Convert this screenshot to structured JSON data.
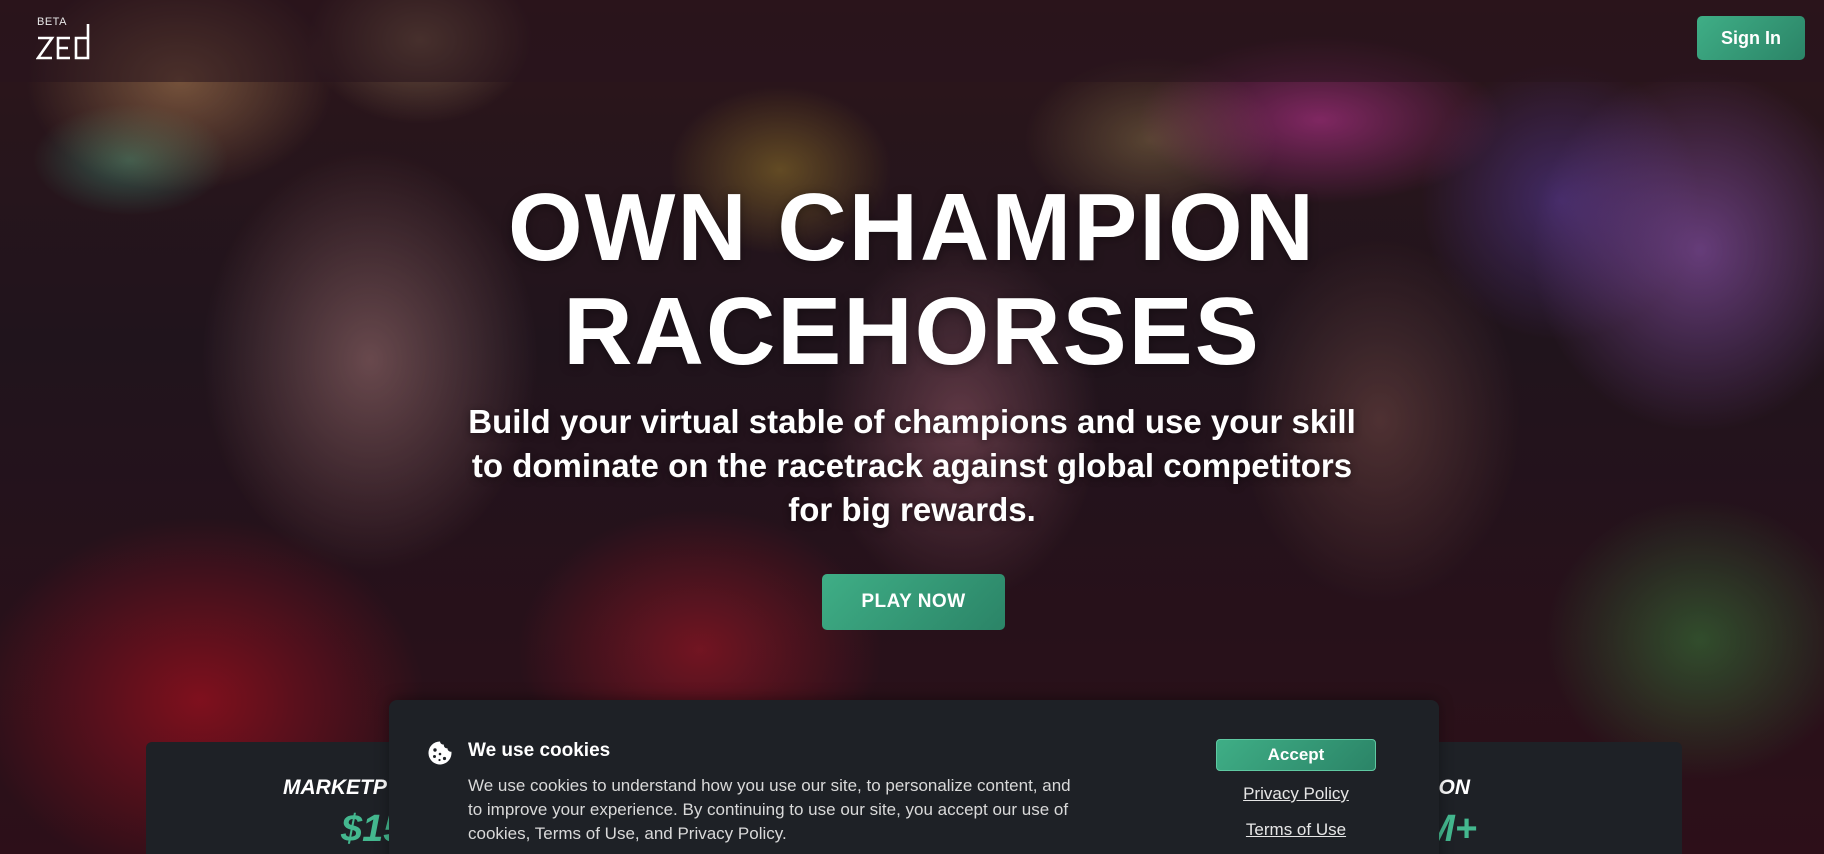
{
  "header": {
    "logo_badge": "BETA",
    "logo_text": "zed",
    "signin_label": "Sign In"
  },
  "hero": {
    "title_line1": "OWN CHAMPION",
    "title_line2": "RACEHORSES",
    "subtitle": "Build your virtual stable of champions and use your skill to dominate on the racetrack against global competitors for big rewards.",
    "cta_label": "PLAY NOW"
  },
  "stats": {
    "left_label_visible": "MARKETP",
    "left_value_visible": "$15",
    "right_label_visible": "ON",
    "right_value_visible": "M+"
  },
  "cookie_banner": {
    "title": "We use cookies",
    "body": "We use cookies to understand how you use our site, to personalize content, and to improve your experience. By continuing to use our site, you accept our use of cookies, Terms of Use, and Privacy Policy.",
    "accept_label": "Accept",
    "privacy_label": "Privacy Policy",
    "terms_label": "Terms of Use"
  },
  "colors": {
    "brand_green": "#3fae86",
    "stat_green": "#44b88f",
    "panel_dark": "#1e2126"
  },
  "icons": [
    "zed-logo",
    "cookie-icon"
  ]
}
